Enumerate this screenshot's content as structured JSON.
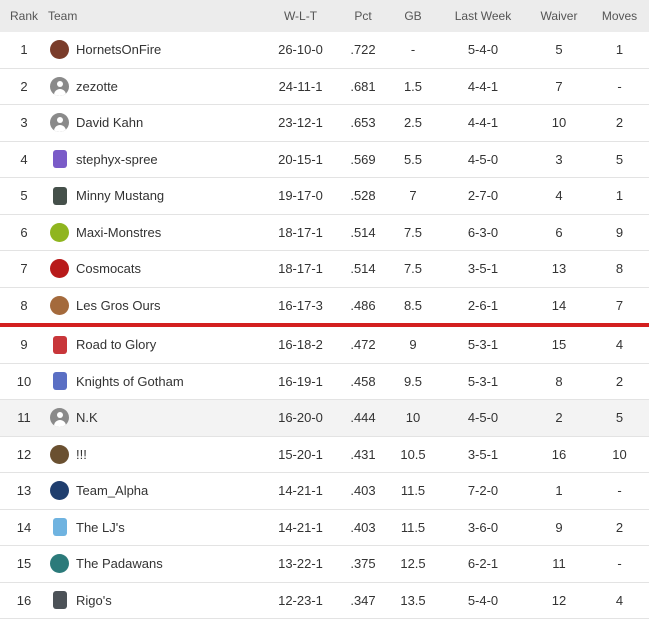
{
  "headers": {
    "rank": "Rank",
    "team": "Team",
    "wlt": "W-L-T",
    "pct": "Pct",
    "gb": "GB",
    "last_week": "Last Week",
    "waiver": "Waiver",
    "moves": "Moves"
  },
  "rows": [
    {
      "rank": "1",
      "team": "HornetsOnFire",
      "wlt": "26-10-0",
      "pct": ".722",
      "gb": "-",
      "last_week": "5-4-0",
      "waiver": "5",
      "moves": "1",
      "logo": "hornet-logo-icon",
      "logo_color": "#7a3c2a"
    },
    {
      "rank": "2",
      "team": "zezotte",
      "wlt": "24-11-1",
      "pct": ".681",
      "gb": "1.5",
      "last_week": "4-4-1",
      "waiver": "7",
      "moves": "-",
      "logo": "default-avatar-icon",
      "logo_color": "#8a8a8a"
    },
    {
      "rank": "3",
      "team": "David Kahn",
      "wlt": "23-12-1",
      "pct": ".653",
      "gb": "2.5",
      "last_week": "4-4-1",
      "waiver": "10",
      "moves": "2",
      "logo": "default-avatar-icon",
      "logo_color": "#8a8a8a"
    },
    {
      "rank": "4",
      "team": "stephyx-spree",
      "wlt": "20-15-1",
      "pct": ".569",
      "gb": "5.5",
      "last_week": "4-5-0",
      "waiver": "3",
      "moves": "5",
      "logo": "purple-jersey-icon",
      "logo_color": "#7a5bc8"
    },
    {
      "rank": "5",
      "team": "Minny Mustang",
      "wlt": "19-17-0",
      "pct": ".528",
      "gb": "7",
      "last_week": "2-7-0",
      "waiver": "4",
      "moves": "1",
      "logo": "dark-jersey-icon",
      "logo_color": "#45504a"
    },
    {
      "rank": "6",
      "team": "Maxi-Monstres",
      "wlt": "18-17-1",
      "pct": ".514",
      "gb": "7.5",
      "last_week": "6-3-0",
      "waiver": "6",
      "moves": "9",
      "logo": "green-monster-icon",
      "logo_color": "#8fb51f"
    },
    {
      "rank": "7",
      "team": "Cosmocats",
      "wlt": "18-17-1",
      "pct": ".514",
      "gb": "7.5",
      "last_week": "3-5-1",
      "waiver": "13",
      "moves": "8",
      "logo": "cat-logo-icon",
      "logo_color": "#b81a1a"
    },
    {
      "rank": "8",
      "team": "Les Gros Ours",
      "wlt": "16-17-3",
      "pct": ".486",
      "gb": "8.5",
      "last_week": "2-6-1",
      "waiver": "14",
      "moves": "7",
      "logo": "bear-logo-icon",
      "logo_color": "#a46a3c"
    },
    {
      "rank": "9",
      "team": "Road to Glory",
      "wlt": "16-18-2",
      "pct": ".472",
      "gb": "9",
      "last_week": "5-3-1",
      "waiver": "15",
      "moves": "4",
      "logo": "red-jersey-icon",
      "logo_color": "#c8363a"
    },
    {
      "rank": "10",
      "team": "Knights of Gotham",
      "wlt": "16-19-1",
      "pct": ".458",
      "gb": "9.5",
      "last_week": "5-3-1",
      "waiver": "8",
      "moves": "2",
      "logo": "blue-jersey-icon",
      "logo_color": "#5a6fc4"
    },
    {
      "rank": "11",
      "team": "N.K",
      "wlt": "16-20-0",
      "pct": ".444",
      "gb": "10",
      "last_week": "4-5-0",
      "waiver": "2",
      "moves": "5",
      "logo": "default-avatar-icon",
      "logo_color": "#8a8a8a"
    },
    {
      "rank": "12",
      "team": "!!!",
      "wlt": "15-20-1",
      "pct": ".431",
      "gb": "10.5",
      "last_week": "3-5-1",
      "waiver": "16",
      "moves": "10",
      "logo": "photo-avatar-icon",
      "logo_color": "#6a5030"
    },
    {
      "rank": "13",
      "team": "Team_Alpha",
      "wlt": "14-21-1",
      "pct": ".403",
      "gb": "11.5",
      "last_week": "7-2-0",
      "waiver": "1",
      "moves": "-",
      "logo": "alpha-logo-icon",
      "logo_color": "#1f3e6e"
    },
    {
      "rank": "14",
      "team": "The LJ's",
      "wlt": "14-21-1",
      "pct": ".403",
      "gb": "11.5",
      "last_week": "3-6-0",
      "waiver": "9",
      "moves": "2",
      "logo": "lightblue-jersey-icon",
      "logo_color": "#6fb3e0"
    },
    {
      "rank": "15",
      "team": "The Padawans",
      "wlt": "13-22-1",
      "pct": ".375",
      "gb": "12.5",
      "last_week": "6-2-1",
      "waiver": "11",
      "moves": "-",
      "logo": "padawan-logo-icon",
      "logo_color": "#2b7a7a"
    },
    {
      "rank": "16",
      "team": "Rigo's",
      "wlt": "12-23-1",
      "pct": ".347",
      "gb": "13.5",
      "last_week": "5-4-0",
      "waiver": "12",
      "moves": "4",
      "logo": "gray-jersey-icon",
      "logo_color": "#4c5257"
    }
  ],
  "cutoff_after_rank": "8",
  "highlighted_rank": "11",
  "colors": {
    "header_bg": "#ececec",
    "highlight_row_bg": "#f3f3f3",
    "playoff_cutoff_line": "#d31f1f",
    "row_divider": "#e3e3e3"
  }
}
